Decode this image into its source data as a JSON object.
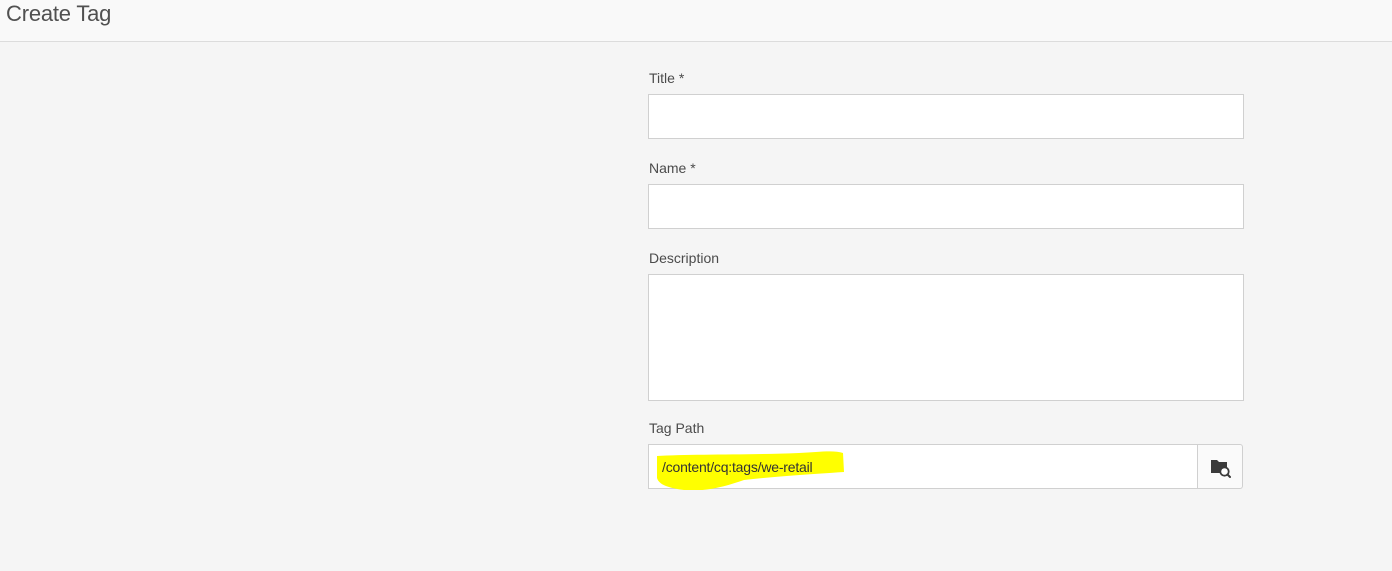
{
  "header": {
    "title": "Create Tag"
  },
  "form": {
    "title_label": "Title *",
    "title_value": "",
    "name_label": "Name *",
    "name_value": "",
    "description_label": "Description",
    "description_value": "",
    "tag_path_label": "Tag Path",
    "tag_path_value": "/content/cq:tags/we-retail"
  },
  "icons": {
    "browse": "folder-search-icon"
  },
  "colors": {
    "highlight": "#ffff00",
    "background": "#f5f5f5",
    "header_background": "#f9f9f9",
    "border": "#d0d0d0"
  }
}
